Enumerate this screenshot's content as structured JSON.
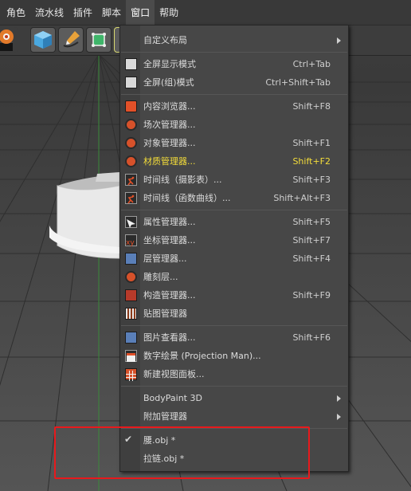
{
  "menubar": {
    "items": [
      {
        "label": "角色",
        "active": false
      },
      {
        "label": "流水线",
        "active": false
      },
      {
        "label": "插件",
        "active": false
      },
      {
        "label": "脚本",
        "active": false
      },
      {
        "label": "窗口",
        "active": true
      },
      {
        "label": "帮助",
        "active": false
      }
    ]
  },
  "menu": {
    "custom_layout": {
      "label": "自定义布局"
    },
    "fullscreen": {
      "label": "全屏显示模式",
      "shortcut": "Ctrl+Tab"
    },
    "fullscreen_group": {
      "label": "全屏(组)模式",
      "shortcut": "Ctrl+Shift+Tab"
    },
    "content_browser": {
      "label": "内容浏览器...",
      "shortcut": "Shift+F8"
    },
    "scene_manager": {
      "label": "场次管理器..."
    },
    "object_manager": {
      "label": "对象管理器...",
      "shortcut": "Shift+F1"
    },
    "material_manager": {
      "label": "材质管理器...",
      "shortcut": "Shift+F2"
    },
    "timeline_dope": {
      "label": "时间线（摄影表）...",
      "shortcut": "Shift+F3"
    },
    "timeline_fcurve": {
      "label": "时间线（函数曲线）...",
      "shortcut": "Shift+Alt+F3"
    },
    "attribute_manager": {
      "label": "属性管理器...",
      "shortcut": "Shift+F5"
    },
    "coordinate_manager": {
      "label": "坐标管理器...",
      "shortcut": "Shift+F7"
    },
    "layer_manager": {
      "label": "层管理器...",
      "shortcut": "Shift+F4"
    },
    "sculpt_layer": {
      "label": "雕刻层..."
    },
    "structure_manager": {
      "label": "构造管理器...",
      "shortcut": "Shift+F9"
    },
    "texture_manager": {
      "label": "贴图管理器"
    },
    "picture_viewer": {
      "label": "图片查看器...",
      "shortcut": "Shift+F6"
    },
    "projection_man": {
      "label": "数字绘景 (Projection Man)..."
    },
    "new_view_panel": {
      "label": "新建视图面板..."
    },
    "bodypaint": {
      "label": "BodyPaint 3D"
    },
    "extra_managers": {
      "label": "附加管理器"
    },
    "doc1": {
      "label": "腰.obj *",
      "checked": true
    },
    "doc2": {
      "label": "拉链.obj *",
      "checked": false
    }
  },
  "colors": {
    "highlight_text": "#f4dd3a",
    "annotation_box": "#e8191c",
    "menu_bg": "#474747"
  }
}
